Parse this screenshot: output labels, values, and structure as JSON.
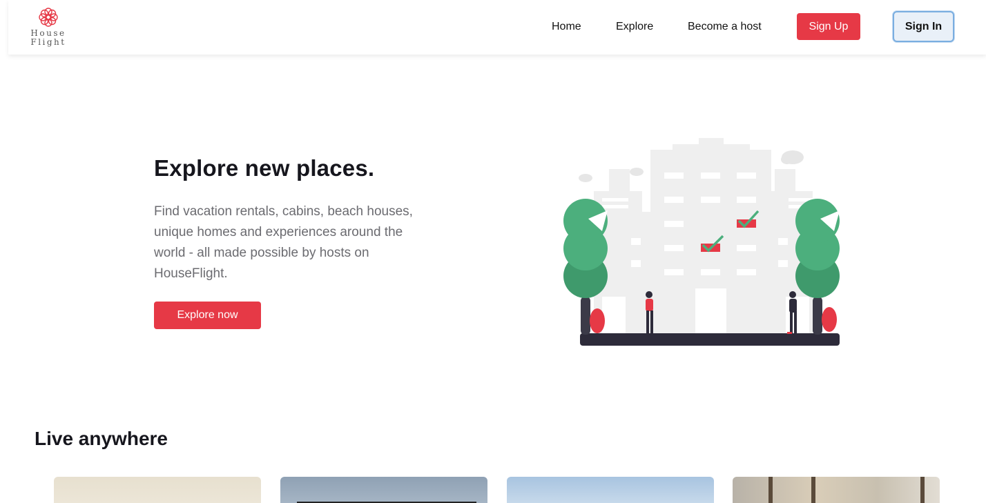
{
  "header": {
    "logo_line1": "House",
    "logo_line2": "Flight",
    "nav": {
      "home": "Home",
      "explore": "Explore",
      "host": "Become a host"
    },
    "sign_up": "Sign Up",
    "sign_in": "Sign In"
  },
  "hero": {
    "title": "Explore new places.",
    "description": "Find vacation rentals, cabins, beach houses, unique homes and experiences around the world - all made possible by hosts on HouseFlight.",
    "cta": "Explore now"
  },
  "section": {
    "title": "Live anywhere"
  },
  "colors": {
    "accent": "#e63946",
    "tree": "#4caf7d",
    "building": "#f0f0f0",
    "ground": "#2d2b3a"
  }
}
